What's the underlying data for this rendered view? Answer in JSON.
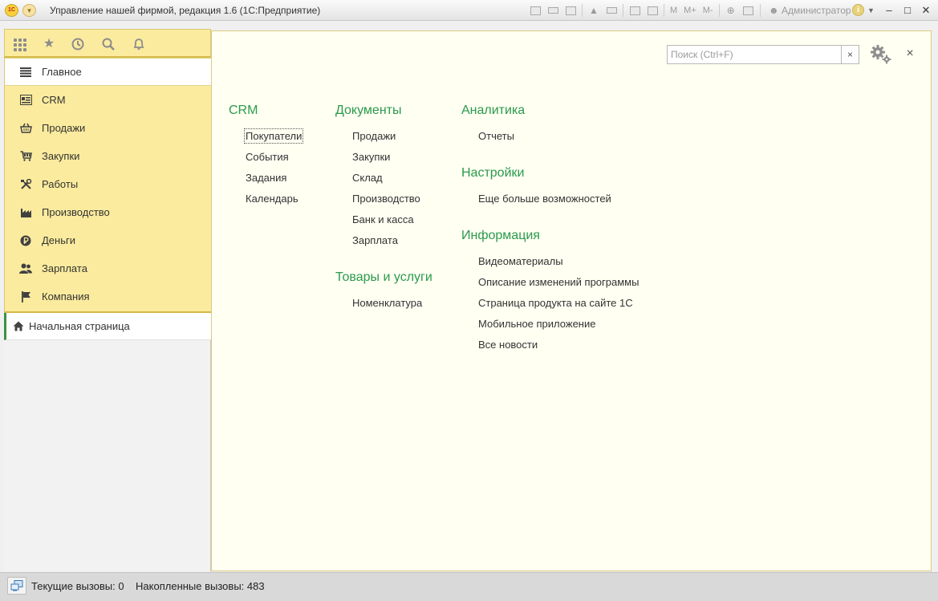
{
  "window": {
    "logo_text": "1С",
    "title": "Управление нашей фирмой, редакция 1.6  (1С:Предприятие)",
    "user": "Администратор",
    "toolbar_m": [
      "M",
      "M+",
      "M-"
    ]
  },
  "search": {
    "placeholder": "Поиск (Ctrl+F)",
    "clear_label": "×"
  },
  "sidebar": {
    "sections": [
      {
        "label": "Главное",
        "icon": "menu-lines-icon",
        "active": true
      },
      {
        "label": "CRM",
        "icon": "crm-card-icon"
      },
      {
        "label": "Продажи",
        "icon": "basket-icon"
      },
      {
        "label": "Закупки",
        "icon": "cart-icon"
      },
      {
        "label": "Работы",
        "icon": "tools-icon"
      },
      {
        "label": "Производство",
        "icon": "factory-icon"
      },
      {
        "label": "Деньги",
        "icon": "ruble-coin-icon"
      },
      {
        "label": "Зарплата",
        "icon": "people-icon"
      },
      {
        "label": "Компания",
        "icon": "flag-icon"
      }
    ],
    "open_tab": "Начальная страница"
  },
  "main": {
    "groups": [
      {
        "title": "CRM",
        "items": [
          "Покупатели",
          "События",
          "Задания",
          "Календарь"
        ]
      },
      {
        "title": "Документы",
        "items": [
          "Продажи",
          "Закупки",
          "Склад",
          "Производство",
          "Банк и касса",
          "Зарплата"
        ]
      },
      {
        "title": "Товары и услуги",
        "items": [
          "Номенклатура"
        ]
      },
      {
        "title": "Аналитика",
        "items": [
          "Отчеты"
        ]
      },
      {
        "title": "Настройки",
        "items": [
          "Еще больше возможностей"
        ]
      },
      {
        "title": "Информация",
        "items": [
          "Видеоматериалы",
          "Описание изменений программы",
          "Страница продукта на сайте 1С",
          "Мобильное приложение",
          "Все новости"
        ]
      }
    ],
    "close_label": "×"
  },
  "status": {
    "current_calls": "Текущие вызовы: 0",
    "accumulated_calls": "Накопленные вызовы: 483"
  },
  "colors": {
    "section_bg": "#fbeb9e",
    "group_title": "#2a9a4c",
    "content_bg": "#fffff2",
    "active_tab_accent": "#3a8f4a"
  }
}
